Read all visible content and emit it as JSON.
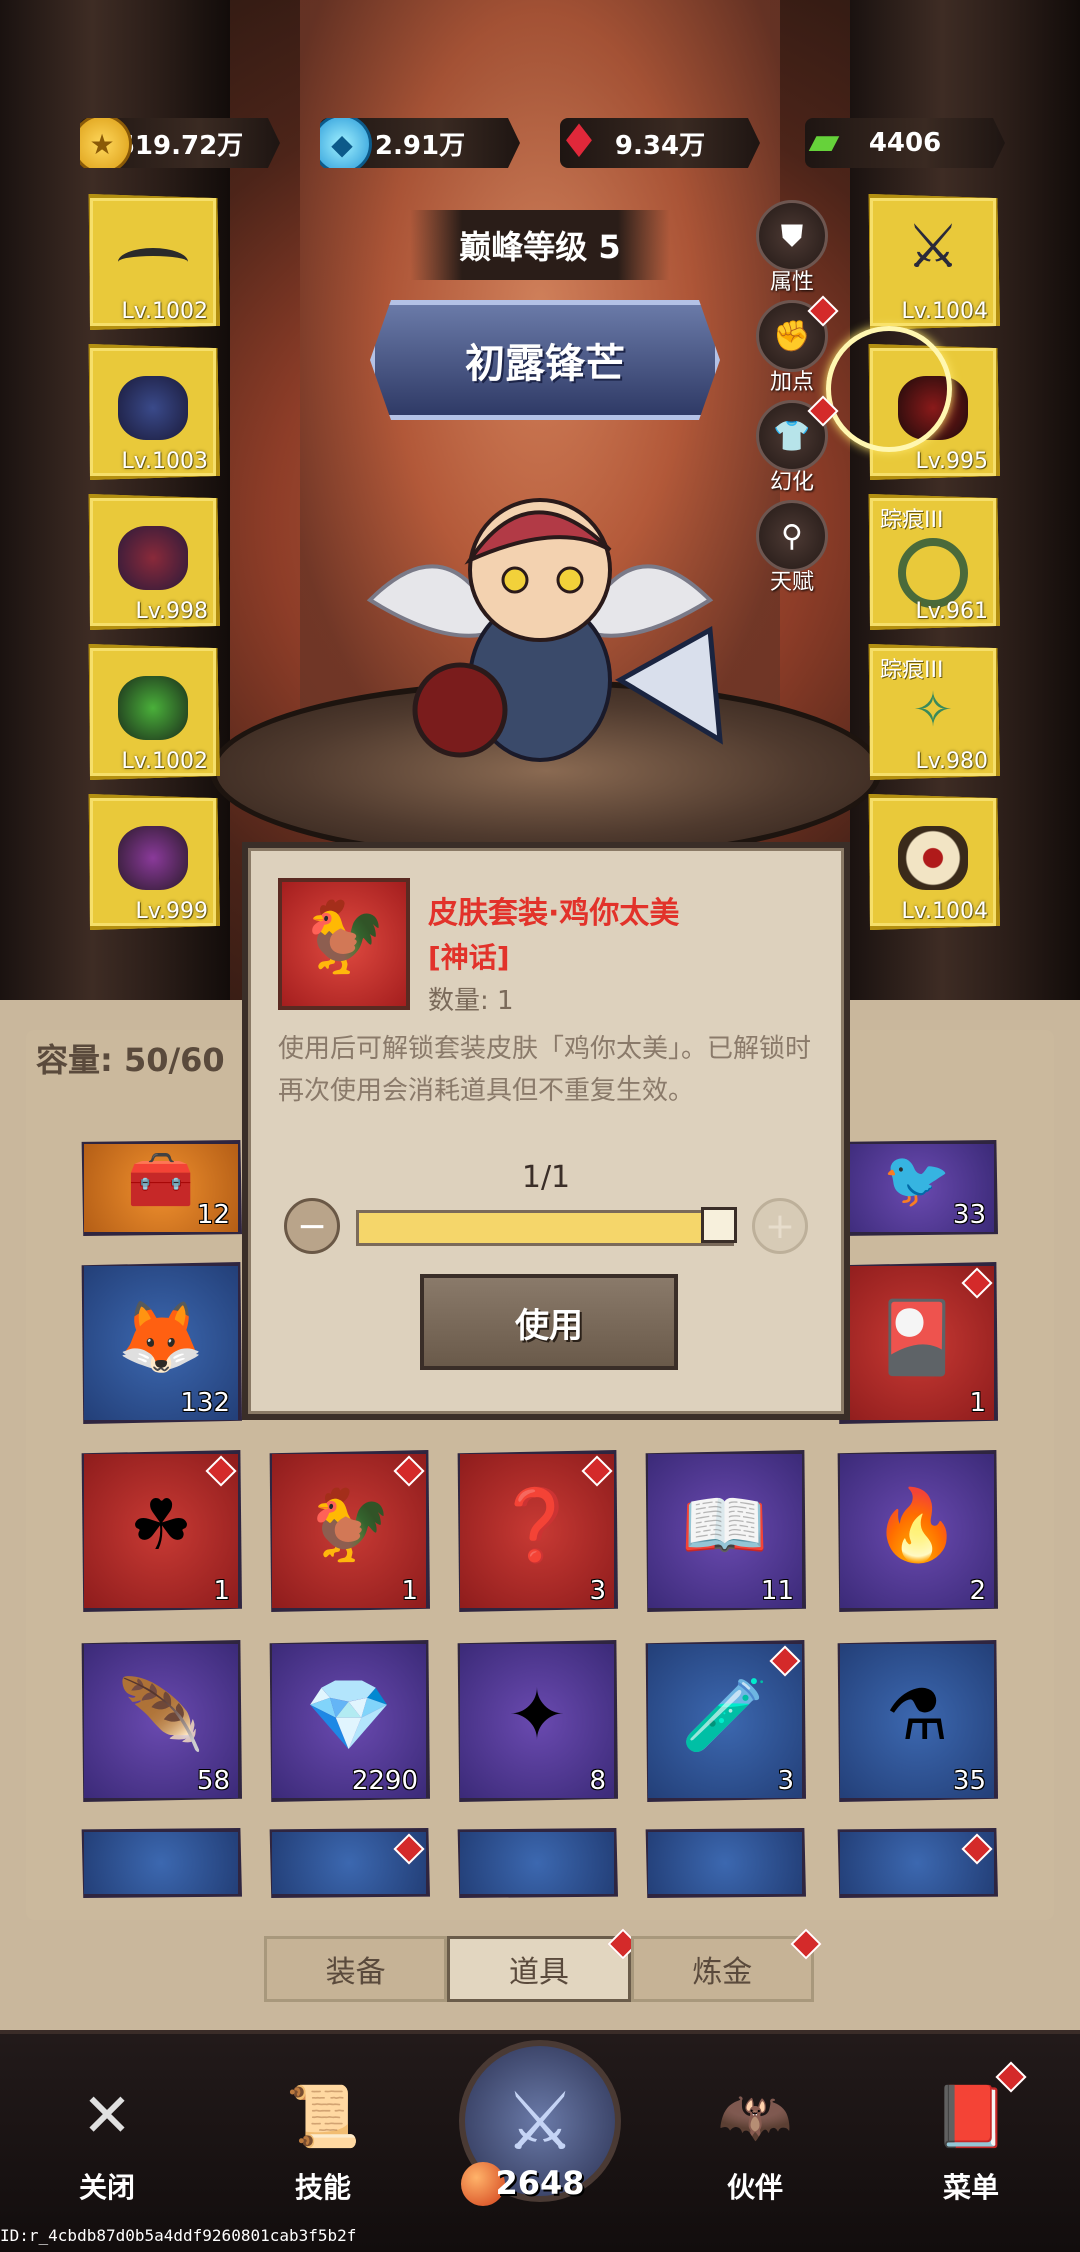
{
  "resources": {
    "gold": "519.72万",
    "diamond": "2.91万",
    "ruby": "9.34万",
    "cash": "4406"
  },
  "hero": {
    "rank": "巅峰等级 5",
    "title": "初露锋芒"
  },
  "left_slots": [
    {
      "level": "Lv.1002"
    },
    {
      "level": "Lv.1003"
    },
    {
      "level": "Lv.998"
    },
    {
      "level": "Lv.1002"
    },
    {
      "level": "Lv.999"
    }
  ],
  "right_slots": [
    {
      "level": "Lv.1004",
      "name": ""
    },
    {
      "level": "Lv.995",
      "name": ""
    },
    {
      "level": "Lv.961",
      "name": "踪痕III"
    },
    {
      "level": "Lv.980",
      "name": "踪痕III"
    },
    {
      "level": "Lv.1004",
      "name": ""
    }
  ],
  "side_buttons": [
    {
      "label": "属性",
      "icon": "attribute-icon"
    },
    {
      "label": "加点",
      "icon": "fist-icon"
    },
    {
      "label": "幻化",
      "icon": "shirt-icon"
    },
    {
      "label": "天赋",
      "icon": "talent-tree-icon"
    }
  ],
  "inventory": {
    "capacity": "容量: 50/60",
    "rows": [
      [
        {
          "count": "12"
        },
        {
          "count": ""
        },
        {
          "count": ""
        },
        {
          "count": ""
        },
        {
          "count": "33"
        }
      ],
      [
        {
          "count": "132"
        },
        {
          "count": ""
        },
        {
          "count": ""
        },
        {
          "count": ""
        },
        {
          "count": "1"
        }
      ],
      [
        {
          "count": "1"
        },
        {
          "count": "1"
        },
        {
          "count": "3"
        },
        {
          "count": "11"
        },
        {
          "count": "2"
        }
      ],
      [
        {
          "count": "58"
        },
        {
          "count": "2290"
        },
        {
          "count": "8"
        },
        {
          "count": "3"
        },
        {
          "count": "35"
        }
      ]
    ]
  },
  "tabs": [
    "装备",
    "道具",
    "炼金"
  ],
  "dialog": {
    "title": "皮肤套装·鸡你太美",
    "rarity": "[神话]",
    "quantity": "数量: 1",
    "description": "使用后可解锁套装皮肤「鸡你太美」。已解锁时再次使用会消耗道具但不重复生效。",
    "count": "1/1",
    "use_label": "使用",
    "fill": 1.0
  },
  "nav": {
    "close": "关闭",
    "skills": "技能",
    "power": "2648",
    "partner": "伙伴",
    "menu": "菜单"
  },
  "footer_id": "ID:r_4cbdb87d0b5a4ddf9260801cab3f5b2f",
  "colors": {
    "rarity_red": "#e2322a",
    "slot_gold": "#e9c93a",
    "slider_fill": "#f5d66a"
  }
}
